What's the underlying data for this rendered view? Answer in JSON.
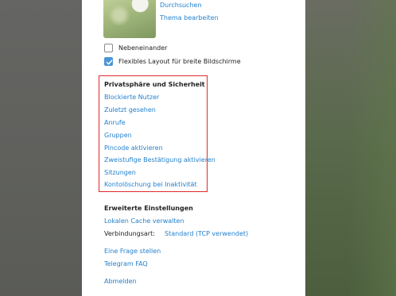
{
  "profile": {
    "browse_link": "Durchsuchen",
    "edit_theme_link": "Thema bearbeiten"
  },
  "layout_options": {
    "side_by_side_label": "Nebeneinander",
    "side_by_side_checked": false,
    "flexible_layout_label": "Flexibles Layout für breite Bildschirme",
    "flexible_layout_checked": true
  },
  "privacy": {
    "title": "Privatsphäre und Sicherheit",
    "items": [
      "Blockierte Nutzer",
      "Zuletzt gesehen",
      "Anrufe",
      "Gruppen",
      "Pincode aktivieren",
      "Zweistufige Bestätigung aktivieren",
      "Sitzungen",
      "Kontolöschung bei Inaktivität"
    ],
    "highlight_color": "#e02a2a"
  },
  "advanced": {
    "title": "Erweiterte Einstellungen",
    "cache_link": "Lokalen Cache verwalten",
    "connection_label": "Verbindungsart:",
    "connection_value": "Standard (TCP verwendet)"
  },
  "help": {
    "ask_question": "Eine Frage stellen",
    "faq": "Telegram FAQ"
  },
  "logout": "Abmelden",
  "colors": {
    "link": "#2481cc",
    "checkbox_accent": "#4a95d6",
    "text": "#222222"
  }
}
